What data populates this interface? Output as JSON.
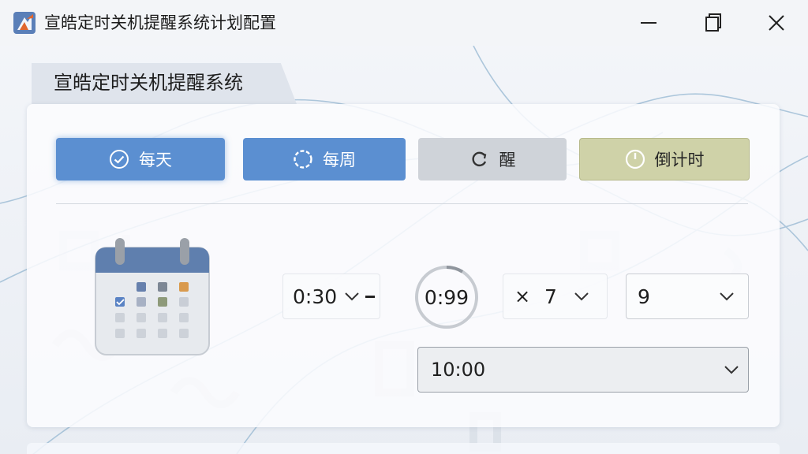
{
  "window": {
    "title": "宣皓定时关机提醒系统计划配置"
  },
  "header": {
    "tab_label": "宣皓定时关机提醒系统"
  },
  "modes": [
    {
      "label": "每天",
      "icon": "check-circle-icon",
      "state": "active",
      "color": "#5b8fd1"
    },
    {
      "label": "每周",
      "icon": "spinner-icon",
      "state": "active",
      "color": "#5b8fd1"
    },
    {
      "label": "醒",
      "icon": "refresh-icon",
      "state": "inactive",
      "color": "#cfd3d9"
    },
    {
      "label": "倒计时",
      "icon": "power-icon",
      "state": "inactive",
      "color": "#cfd2a8"
    }
  ],
  "controls": {
    "hour_select": {
      "value": "0:30"
    },
    "timer": {
      "value": "0:99"
    },
    "repeat_select": {
      "prefix": "×",
      "value": "7"
    },
    "count_select": {
      "value": "9"
    },
    "time_select": {
      "value": "10:00"
    }
  },
  "illustration": {
    "icon": "calendar-icon"
  }
}
